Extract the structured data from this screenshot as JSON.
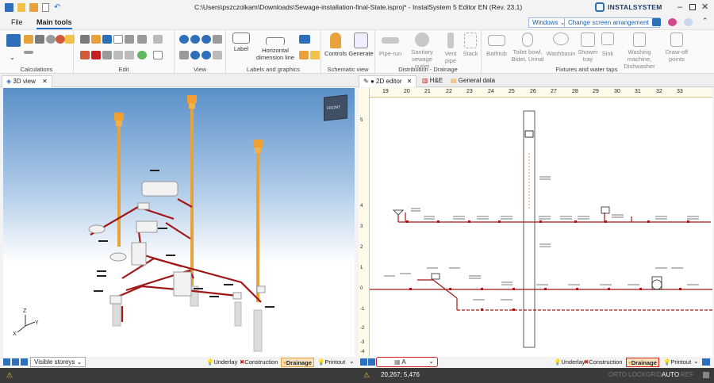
{
  "titlebar": {
    "title": "C:\\Users\\pszczolkam\\Downloads\\Sewage-installation-final-State.isproj* - InstalSystem 5 Editor EN (Rev. 23.1)",
    "brand": "INSTALSYSTEM"
  },
  "menu": {
    "file": "File",
    "main_tools": "Main tools",
    "windows": "Windows",
    "arrangement": "Change screen arrangement"
  },
  "ribbon": {
    "groups": {
      "calculations": "Calculations",
      "edit": "Edit",
      "view": "View",
      "labels": "Labels and graphics",
      "schematic": "Schematic view",
      "distribution": "Distribution - Drainage",
      "fixtures": "Fixtures and water taps"
    },
    "buttons": {
      "label": "Label",
      "horizontal_dim": "Horizontal dimension line",
      "controls": "Controls",
      "generate": "Generate",
      "pipe_run": "Pipe-run",
      "sanitary_outlet": "Sanitary sewage outlet",
      "vent_pipe": "Vent pipe",
      "stack": "Stack",
      "bathtub": "Bathtub",
      "toilet": "Toilet bowl, Bidet, Urinal",
      "washbasin": "Washbasin",
      "shower": "Shower tray",
      "sink": "Sink",
      "washing": "Washing machine, Dishwasher",
      "drain_points": "Draw-off points"
    }
  },
  "left": {
    "tab": "3D view",
    "view_cube": "FRONT",
    "storeys": "Visible storeys",
    "modes": {
      "underlay": "Underlay",
      "construction": "Construction",
      "drainage": "Drainage",
      "printout": "Printout"
    }
  },
  "right": {
    "tabs": [
      "2D editor",
      "H&E",
      "General data"
    ],
    "ruler": [
      "19",
      "20",
      "21",
      "22",
      "23",
      "24",
      "25",
      "26",
      "27",
      "28",
      "29",
      "30",
      "31",
      "32",
      "33"
    ],
    "vruler": [
      "5",
      "4",
      "3",
      "2",
      "1",
      "0",
      "-1",
      "-2",
      "-3",
      "-4"
    ],
    "storey": "A",
    "modes": {
      "underlay": "Underlay",
      "construction": "Construction",
      "drainage": "Drainage",
      "printout": "Printout"
    }
  },
  "status": {
    "coords": "20,267; 5,476",
    "flags": [
      "ORTO",
      "LOCK",
      "GRID",
      "AUTO",
      "REF"
    ]
  },
  "colors": {
    "accent": "#1f6fc5",
    "pipe": "#a01818",
    "stack": "#e8a23b"
  }
}
